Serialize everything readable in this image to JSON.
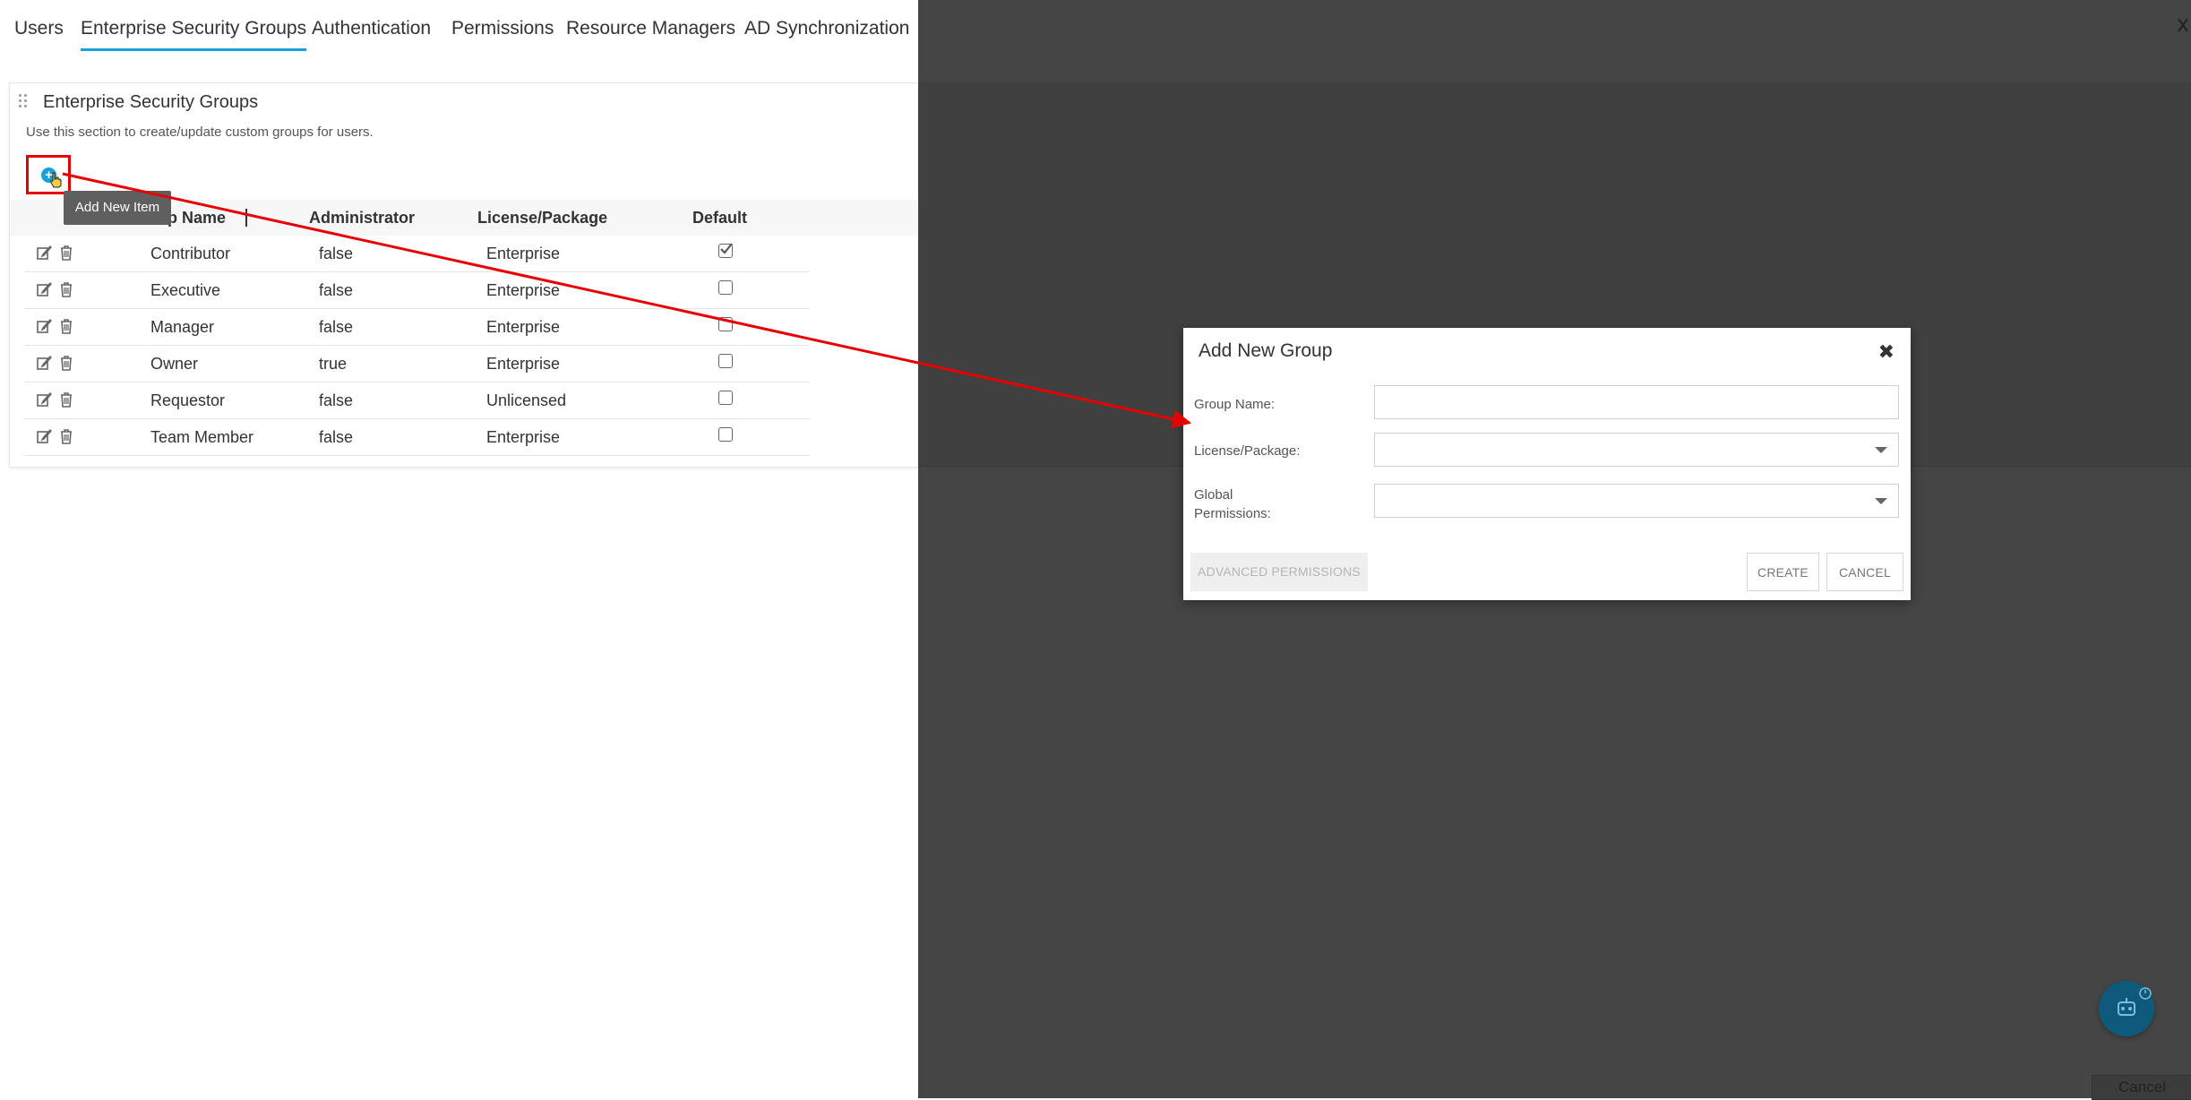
{
  "tabs": [
    {
      "label": "Users",
      "active": false
    },
    {
      "label": "Enterprise Security Groups",
      "active": true
    },
    {
      "label": "Authentication",
      "active": false
    },
    {
      "label": "Permissions",
      "active": false
    },
    {
      "label": "Resource Managers",
      "active": false
    },
    {
      "label": "AD Synchronization",
      "active": false
    }
  ],
  "panel": {
    "title": "Enterprise Security Groups",
    "description": "Use this section to create/update custom groups for users.",
    "add_button_tooltip": "Add New Item",
    "add_button_icon": "add-icon"
  },
  "table": {
    "columns": [
      "Group Name",
      "Administrator",
      "License/Package",
      "Default"
    ],
    "visible_group_header": "p Name",
    "rows": [
      {
        "name": "Contributor",
        "administrator": "false",
        "license": "Enterprise",
        "default": true
      },
      {
        "name": "Executive",
        "administrator": "false",
        "license": "Enterprise",
        "default": false
      },
      {
        "name": "Manager",
        "administrator": "false",
        "license": "Enterprise",
        "default": false
      },
      {
        "name": "Owner",
        "administrator": "true",
        "license": "Enterprise",
        "default": false
      },
      {
        "name": "Requestor",
        "administrator": "false",
        "license": "Unlicensed",
        "default": false
      },
      {
        "name": "Team Member",
        "administrator": "false",
        "license": "Enterprise",
        "default": false
      }
    ]
  },
  "modal": {
    "title": "Add New Group",
    "fields": {
      "group_name_label": "Group Name:",
      "group_name_value": "",
      "license_label": "License/Package:",
      "license_value": "",
      "global_permissions_label_1": "Global",
      "global_permissions_label_2": "Permissions:",
      "global_permissions_value": ""
    },
    "buttons": {
      "advanced": "ADVANCED PERMISSIONS",
      "create": "CREATE",
      "cancel": "CANCEL"
    }
  },
  "background": {
    "cancel_label": "Cancel"
  },
  "colors": {
    "accent": "#1a9fd6",
    "overlay": "#454545",
    "annotation": "#e60000",
    "fab": "#0d5a7d"
  }
}
